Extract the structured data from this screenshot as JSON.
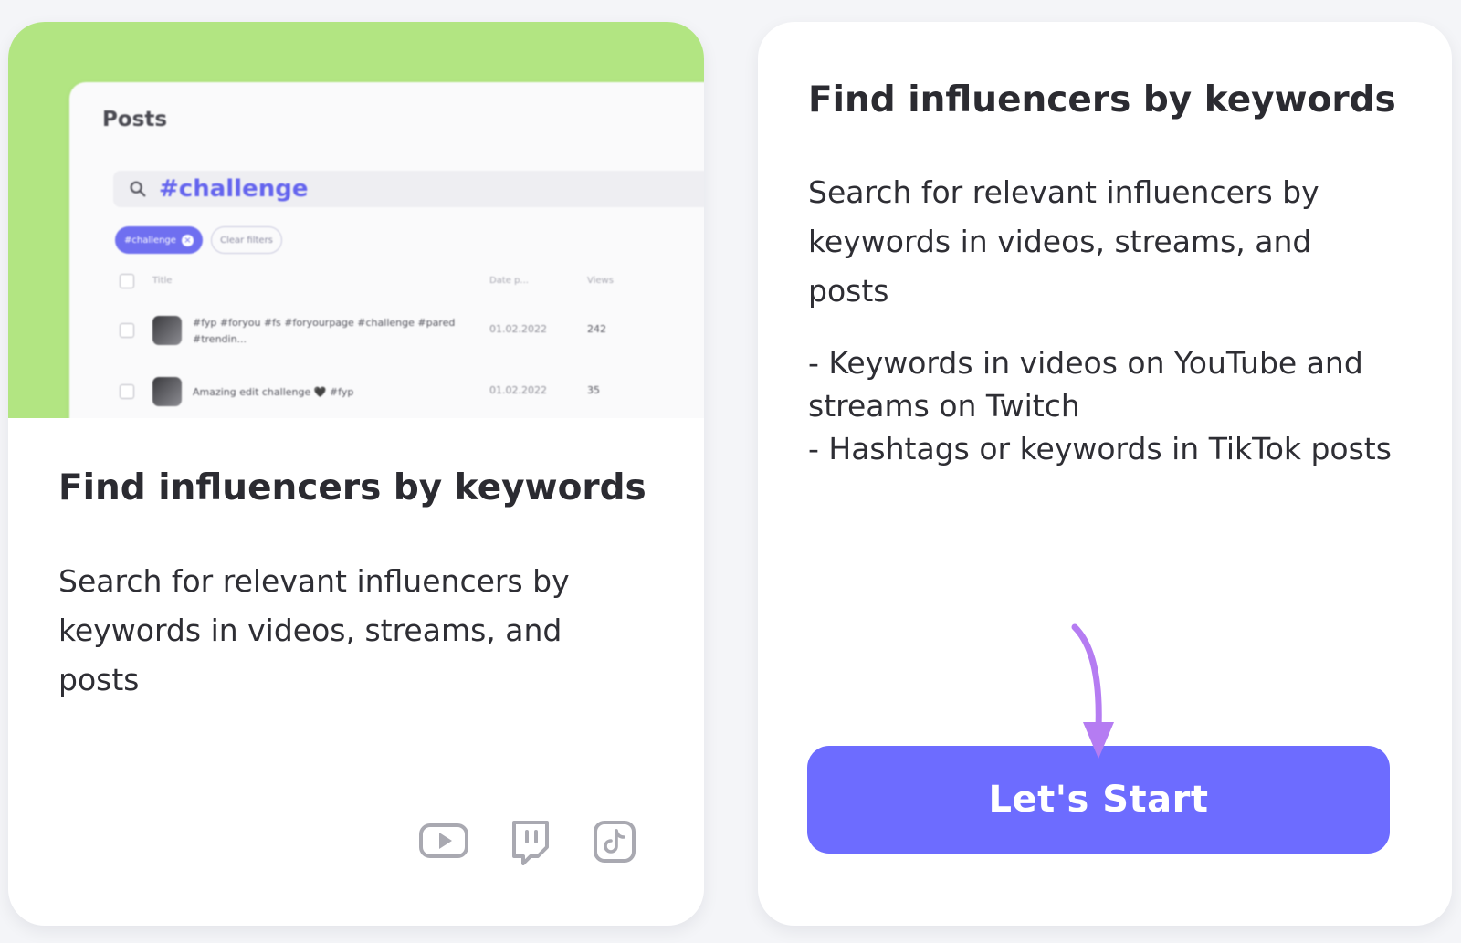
{
  "left_card": {
    "preview": {
      "panel_title": "Posts",
      "search_value": "#challenge",
      "active_filter_chip": "#challenge",
      "clear_filters_label": "Clear filters",
      "table": {
        "headers": [
          "Title",
          "Date p...",
          "Views"
        ],
        "rows": [
          {
            "title": "#fyp #foryou #fs #foryourpage #challenge #pared #trendin...",
            "date": "01.02.2022",
            "views": "242"
          },
          {
            "title": "Amazing edit challenge 🖤 #fyp",
            "date": "01.02.2022",
            "views": "35"
          }
        ]
      }
    },
    "title": "Find influencers by keywords",
    "description": "Search for relevant influencers by keywords in videos, streams, and posts",
    "platform_icons": [
      "youtube-icon",
      "twitch-icon",
      "tiktok-icon"
    ]
  },
  "right_card": {
    "title": "Find influencers by keywords",
    "description": "Search for relevant influencers by keywords in videos, streams, and posts",
    "bullets": [
      "- Keywords in videos on YouTube and streams on Twitch",
      "- Hashtags or keywords in TikTok posts"
    ],
    "cta_label": "Let's Start"
  },
  "colors": {
    "preview_green": "#b2e582",
    "accent_purple": "#6d6cff",
    "arrow_violet": "#b57cf2",
    "page_background": "#f4f5f8"
  }
}
